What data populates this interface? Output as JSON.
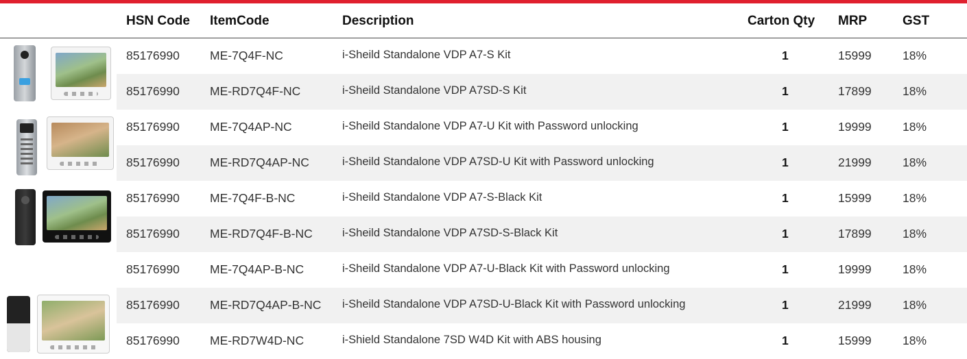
{
  "table": {
    "headers": {
      "hsn": "HSN Code",
      "item": "ItemCode",
      "desc": "Description",
      "qty": "Carton Qty",
      "mrp": "MRP",
      "gst": "GST"
    },
    "rows": [
      {
        "hsn": "85176990",
        "item": "ME-7Q4F-NC",
        "desc": "i-Sheild Standalone VDP A7-S Kit",
        "qty": "1",
        "mrp": "15999",
        "gst": "18%"
      },
      {
        "hsn": "85176990",
        "item": "ME-RD7Q4F-NC",
        "desc": "i-Sheild Standalone VDP  A7SD-S Kit",
        "qty": "1",
        "mrp": "17899",
        "gst": "18%"
      },
      {
        "hsn": "85176990",
        "item": "ME-7Q4AP-NC",
        "desc": "i-Sheild Standalone VDP A7-U Kit with Password unlocking",
        "qty": "1",
        "mrp": "19999",
        "gst": "18%"
      },
      {
        "hsn": "85176990",
        "item": "ME-RD7Q4AP-NC",
        "desc": "i-Sheild Standalone VDP  A7SD-U Kit with Password unlocking",
        "qty": "1",
        "mrp": "21999",
        "gst": "18%"
      },
      {
        "hsn": "85176990",
        "item": "ME-7Q4F-B-NC",
        "desc": "i-Sheild Standalone VDP A7-S-Black Kit",
        "qty": "1",
        "mrp": "15999",
        "gst": "18%"
      },
      {
        "hsn": "85176990",
        "item": "ME-RD7Q4F-B-NC",
        "desc": "i-Sheild Standalone VDP A7SD-S-Black Kit",
        "qty": "1",
        "mrp": "17899",
        "gst": "18%"
      },
      {
        "hsn": "85176990",
        "item": "ME-7Q4AP-B-NC",
        "desc": "i-Sheild Standalone VDP A7-U-Black Kit  with Password unlocking",
        "qty": "1",
        "mrp": "19999",
        "gst": "18%"
      },
      {
        "hsn": "85176990",
        "item": "ME-RD7Q4AP-B-NC",
        "desc": "i-Sheild Standalone  VDP A7SD-U-Black Kit with Password unlocking",
        "qty": "1",
        "mrp": "21999",
        "gst": "18%"
      },
      {
        "hsn": "85176990",
        "item": "ME-RD7W4D-NC",
        "desc": "i-Shield Standalone 7SD W4D Kit with ABS housing",
        "qty": "1",
        "mrp": "15999",
        "gst": "18%"
      }
    ]
  },
  "colors": {
    "accent": "#e0202e",
    "row_alt": "#f1f1f1"
  },
  "product_images": [
    "silver-doorcam-white-monitor",
    "silver-keypad-doorcam-white-monitor",
    "black-doorcam-black-monitor",
    "black-doorcam-white-monitor"
  ]
}
